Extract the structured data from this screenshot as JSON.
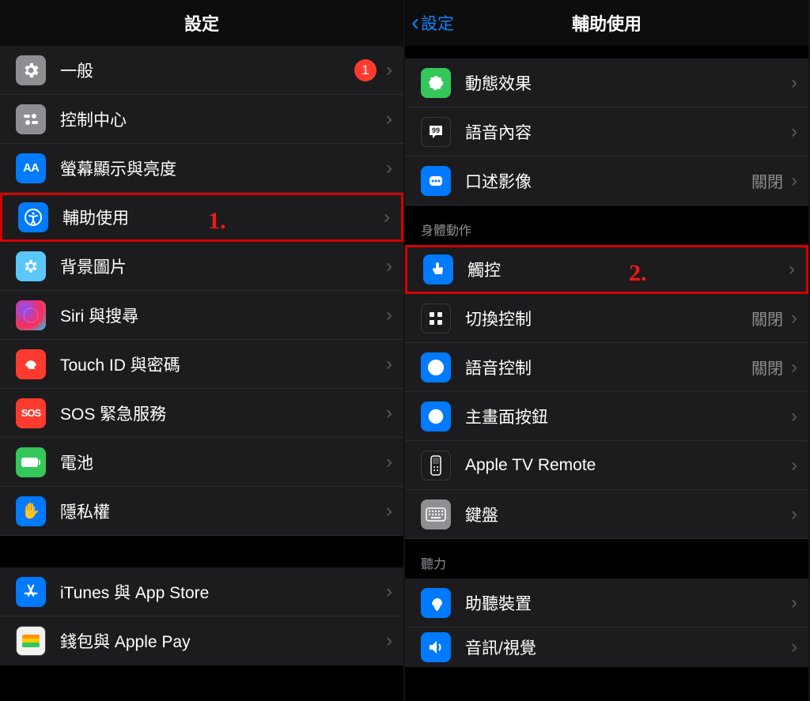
{
  "left": {
    "title": "設定",
    "annotation": "1.",
    "group1": [
      {
        "icon": "gear-icon",
        "bg": "bg-gray",
        "label": "一般",
        "badge": "1"
      },
      {
        "icon": "control-center-icon",
        "bg": "bg-gray",
        "label": "控制中心"
      },
      {
        "icon": "display-icon",
        "bg": "bg-blue",
        "label": "螢幕顯示與亮度"
      },
      {
        "icon": "accessibility-icon",
        "bg": "bg-blue",
        "label": "輔助使用",
        "highlight": true
      },
      {
        "icon": "wallpaper-icon",
        "bg": "bg-lightblue",
        "label": "背景圖片"
      },
      {
        "icon": "siri-icon",
        "bg": "bg-grad",
        "label": "Siri 與搜尋"
      },
      {
        "icon": "touchid-icon",
        "bg": "bg-red",
        "label": "Touch ID 與密碼"
      },
      {
        "icon": "sos-icon",
        "bg": "bg-sos",
        "label": "SOS 緊急服務"
      },
      {
        "icon": "battery-icon",
        "bg": "bg-green",
        "label": "電池"
      },
      {
        "icon": "privacy-icon",
        "bg": "bg-blue",
        "label": "隱私權"
      }
    ],
    "group2": [
      {
        "icon": "appstore-icon",
        "bg": "bg-blue",
        "label": "iTunes 與 App Store"
      },
      {
        "icon": "wallet-icon",
        "bg": "bg-wallet",
        "label": "錢包與 Apple Pay"
      }
    ]
  },
  "right": {
    "back_label": "設定",
    "title": "輔助使用",
    "annotation": "2.",
    "group1": [
      {
        "icon": "motion-icon",
        "bg": "bg-green",
        "label": "動態效果"
      },
      {
        "icon": "spoken-content-icon",
        "bg": "bg-dark",
        "label": "語音內容"
      },
      {
        "icon": "audio-desc-icon",
        "bg": "bg-blue",
        "label": "口述影像",
        "value": "關閉"
      }
    ],
    "section2_header": "身體動作",
    "group2": [
      {
        "icon": "touch-icon",
        "bg": "bg-blue",
        "label": "觸控",
        "highlight": true
      },
      {
        "icon": "switch-control-icon",
        "bg": "bg-dark",
        "label": "切換控制",
        "value": "關閉"
      },
      {
        "icon": "voice-control-icon",
        "bg": "bg-blue",
        "label": "語音控制",
        "value": "關閉"
      },
      {
        "icon": "home-button-icon",
        "bg": "bg-blue",
        "label": "主畫面按鈕"
      },
      {
        "icon": "tv-remote-icon",
        "bg": "bg-dark",
        "label": "Apple TV Remote"
      },
      {
        "icon": "keyboard-icon",
        "bg": "bg-gray",
        "label": "鍵盤"
      }
    ],
    "section3_header": "聽力",
    "group3": [
      {
        "icon": "hearing-icon",
        "bg": "bg-blue",
        "label": "助聽裝置"
      },
      {
        "icon": "audio-visual-icon",
        "bg": "bg-blue",
        "label": "音訊/視覺"
      }
    ]
  }
}
